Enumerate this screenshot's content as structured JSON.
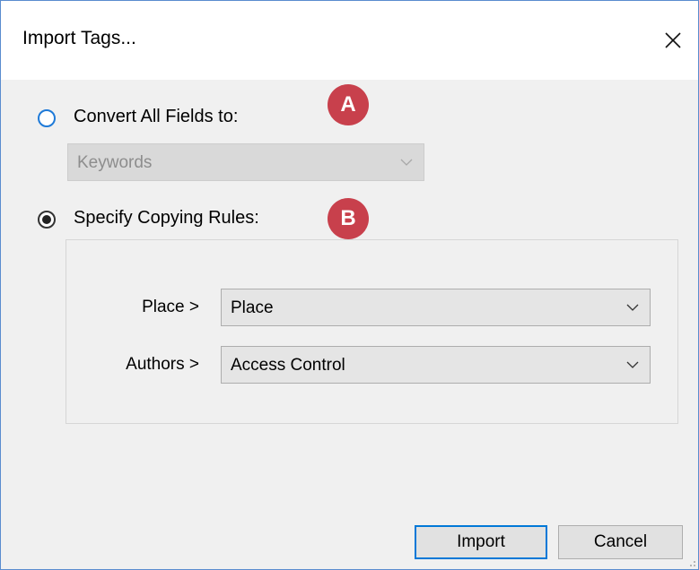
{
  "window": {
    "title": "Import Tags...",
    "close_label": "Close"
  },
  "options": {
    "convert_all": {
      "label": "Convert All Fields to:",
      "selected": false,
      "value": "Keywords",
      "enabled": false
    },
    "specify_rules": {
      "label": "Specify Copying Rules:",
      "selected": true
    }
  },
  "badges": {
    "a": "A",
    "b": "B"
  },
  "rules": [
    {
      "label": "Place >",
      "value": "Place"
    },
    {
      "label": "Authors >",
      "value": "Access Control"
    }
  ],
  "buttons": {
    "import_label": "Import",
    "cancel_label": "Cancel"
  },
  "colors": {
    "accent": "#0078d7",
    "badge": "#c8404c",
    "window_border": "#5a8ccf"
  }
}
